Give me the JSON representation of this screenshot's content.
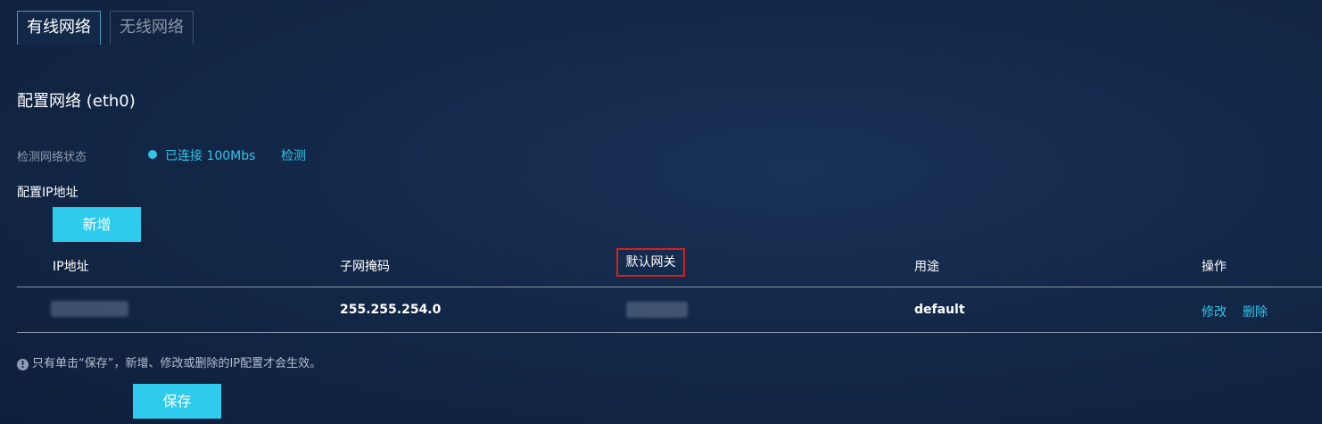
{
  "tabs": [
    {
      "label": "有线网络",
      "active": true
    },
    {
      "label": "无线网络",
      "active": false
    }
  ],
  "title": "配置网络 (eth0)",
  "status": {
    "label": "检测网络状态",
    "value": "已连接 100Mbs",
    "detect_link": "检测"
  },
  "ip_section": {
    "label": "配置IP地址",
    "add_button": "新增",
    "columns": [
      "IP地址",
      "子网掩码",
      "默认网关",
      "用途",
      "操作"
    ],
    "rows": [
      {
        "ip": "",
        "mask": "255.255.254.0",
        "gateway": "",
        "use": "default",
        "edit": "修改",
        "delete": "删除"
      }
    ]
  },
  "note": {
    "icon": "!",
    "text": "只有单击“保存”，新增、修改或删除的IP配置才会生效。"
  },
  "save_button": "保存",
  "colors": {
    "accent": "#2fcbec",
    "highlight_border": "#d42020",
    "background": "#132848"
  }
}
